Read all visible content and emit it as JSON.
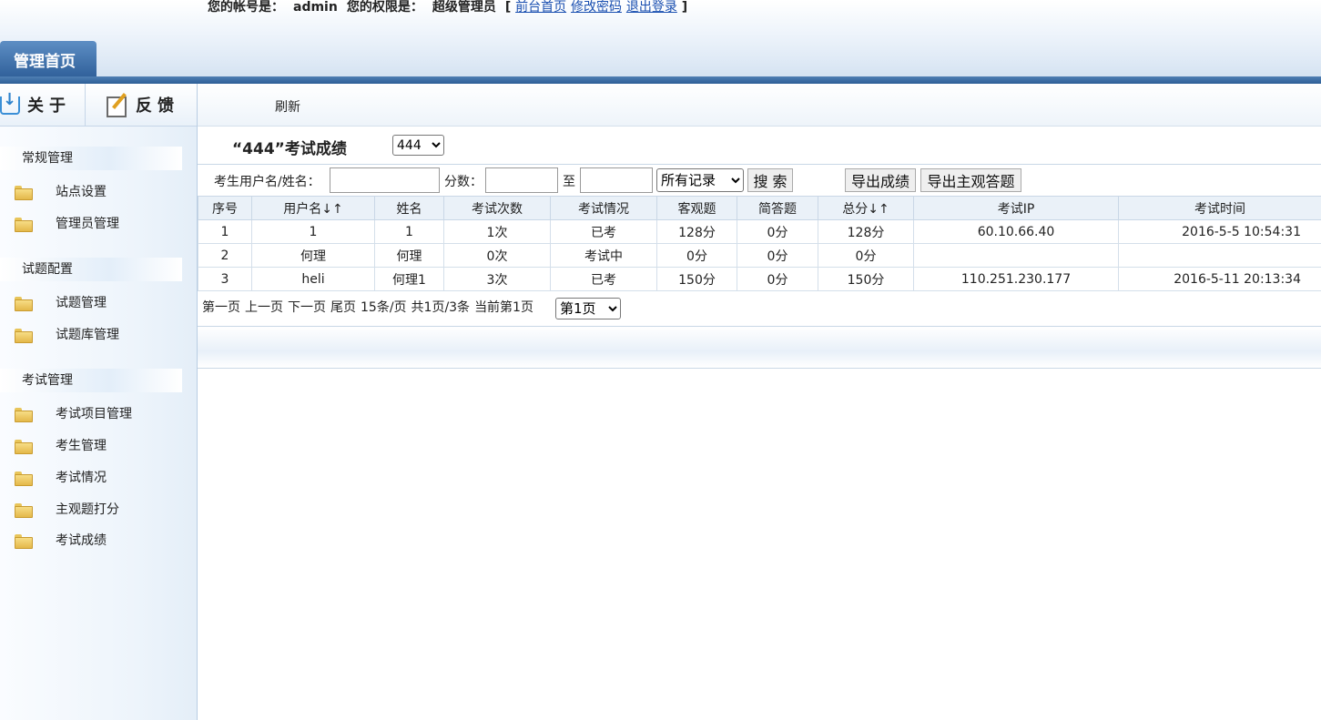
{
  "header": {
    "account_label": "您的帐号是：",
    "account_value": "admin",
    "role_label": "您的权限是：",
    "role_value": "超级管理员",
    "bracket_open": "[",
    "link_home": "前台首页",
    "link_password": "修改密码",
    "link_logout": "退出登录",
    "bracket_close": "]",
    "tab_home": "管理首页"
  },
  "sidebar": {
    "about_label": "关于",
    "feedback_label": "反馈",
    "groups": [
      {
        "title": "常规管理",
        "items": [
          "站点设置",
          "管理员管理"
        ]
      },
      {
        "title": "试题配置",
        "items": [
          "试题管理",
          "试题库管理"
        ]
      },
      {
        "title": "考试管理",
        "items": [
          "考试项目管理",
          "考生管理",
          "考试情况",
          "主观题打分",
          "考试成绩"
        ]
      }
    ]
  },
  "toolbar": {
    "refresh": "刷新"
  },
  "page": {
    "title": "“444”考试成绩",
    "exam_selected": "444"
  },
  "search": {
    "user_label": "考生用户名/姓名：",
    "user_value": "",
    "score_label": "分数：",
    "score_from": "",
    "to_label": "至",
    "score_to": "",
    "filter_selected": "所有记录",
    "search_button": "搜 索",
    "export_scores": "导出成绩",
    "export_subjective": "导出主观答题"
  },
  "table": {
    "columns": [
      "序号",
      "用户名↓↑",
      "姓名",
      "考试次数",
      "考试情况",
      "客观题",
      "简答题",
      "总分↓↑",
      "考试IP",
      "考试时间"
    ],
    "rows": [
      {
        "no": "1",
        "username": "1",
        "name": "1",
        "count": "1次",
        "status": "已考",
        "status_type": "done",
        "objective": "128分",
        "short": "0分",
        "total": "128分",
        "ip": "60.10.66.40",
        "time": "2016-5-5 10:54:31"
      },
      {
        "no": "2",
        "username": "何理",
        "name": "何理",
        "count": "0次",
        "status": "考试中",
        "status_type": "ing",
        "objective": "0分",
        "short": "0分",
        "total": "0分",
        "ip": "",
        "time": ""
      },
      {
        "no": "3",
        "username": "heli",
        "name": "何理1",
        "count": "3次",
        "status": "已考",
        "status_type": "done",
        "objective": "150分",
        "short": "0分",
        "total": "150分",
        "ip": "110.251.230.177",
        "time": "2016-5-11 20:13:34"
      }
    ]
  },
  "pager": {
    "first": "第一页",
    "prev": "上一页",
    "next": "下一页",
    "last": "尾页",
    "per_page": "15条/页",
    "summary": "共1页/3条",
    "current": "当前第1页",
    "page_selected": "第1页"
  },
  "colors": {
    "status_done": "#1fa52b",
    "status_ing": "#1f35c9",
    "tab_blue": "#2f5f99",
    "link_blue": "#1a4fb0"
  }
}
